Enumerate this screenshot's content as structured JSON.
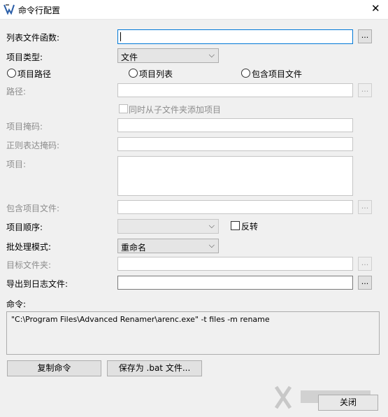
{
  "window": {
    "title": "命令行配置",
    "close_glyph": "✕"
  },
  "icons": {
    "app": "app-icon",
    "close": "close-icon",
    "chevron": "chevron-down-icon"
  },
  "list_func": {
    "label": "列表文件函数:",
    "value": "",
    "browse": "..."
  },
  "item_type": {
    "label": "项目类型:",
    "selected": "文件",
    "chevron": "⌵"
  },
  "radios": {
    "path": "项目路径",
    "list": "项目列表",
    "include": "包含项目文件"
  },
  "path": {
    "label": "路径:",
    "browse": "..."
  },
  "subfolders": {
    "label": "同时从子文件夹添加项目"
  },
  "mask": {
    "label": "项目掩码:"
  },
  "regex": {
    "label": "正则表达掩码:"
  },
  "items": {
    "label": "项目:"
  },
  "include_file": {
    "label": "包含项目文件:",
    "browse": "..."
  },
  "order": {
    "label": "项目顺序:",
    "selected": "",
    "reverse": "反转"
  },
  "batch_mode": {
    "label": "批处理模式:",
    "selected": "重命名"
  },
  "target_folder": {
    "label": "目标文件夹:",
    "browse": "..."
  },
  "log_file": {
    "label": "导出到日志文件:",
    "browse": "..."
  },
  "command": {
    "label": "命令:",
    "text": "\"C:\\Program Files\\Advanced Renamer\\arenc.exe\" -t files -m rename"
  },
  "buttons": {
    "copy": "复制命令",
    "save_bat": "保存为 .bat 文件...",
    "close": "关闭"
  }
}
